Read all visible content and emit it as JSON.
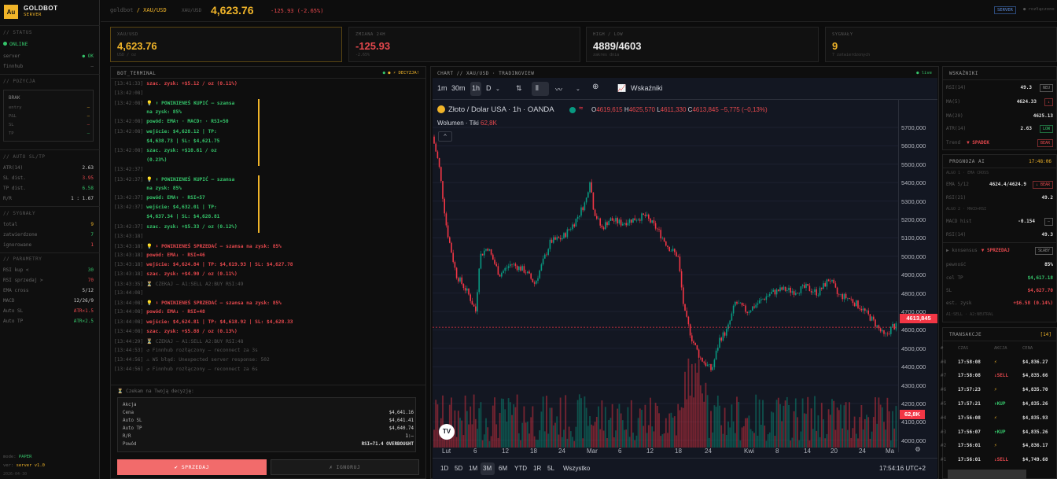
{
  "brand": {
    "logo": "Au",
    "name": "GOLDBOT",
    "sub": "SERVER"
  },
  "sidebar": {
    "status": {
      "title": "// STATUS",
      "online": "ONLINE",
      "server_label": "server",
      "server_value": "● OK",
      "finnhub_label": "finnhub",
      "finnhub_value": "—"
    },
    "position": {
      "title": "// POZYCJA",
      "state": "BRAK",
      "rows": [
        {
          "label": "entry",
          "value": "—"
        },
        {
          "label": "P&L",
          "value": "—"
        },
        {
          "label": "SL",
          "value": "—"
        },
        {
          "label": "TP",
          "value": "—"
        }
      ]
    },
    "autosltp": {
      "title": "// AUTO SL/TP",
      "rows": [
        {
          "label": "ATR(14)",
          "value": "2.63"
        },
        {
          "label": "SL dist.",
          "value": "3.95"
        },
        {
          "label": "TP dist.",
          "value": "6.58"
        },
        {
          "label": "R/R",
          "value": "1 : 1.67"
        }
      ]
    },
    "signals": {
      "title": "// SYGNAŁY",
      "rows": [
        {
          "label": "total",
          "value": "9"
        },
        {
          "label": "zatwierdzone",
          "value": "7"
        },
        {
          "label": "ignorowane",
          "value": "1"
        }
      ]
    },
    "params": {
      "title": "// PARAMETRY",
      "rows": [
        {
          "label": "RSI kup <",
          "value": "30"
        },
        {
          "label": "RSI sprzedaj >",
          "value": "70"
        },
        {
          "label": "EMA cross",
          "value": "5/12"
        },
        {
          "label": "MACD",
          "value": "12/26/9"
        },
        {
          "label": "Auto SL",
          "value": "ATR×1.5"
        },
        {
          "label": "Auto TP",
          "value": "ATR×2.5"
        }
      ]
    },
    "footer": {
      "mode_label": "mode:",
      "mode": "PAPER",
      "ver_label": "ver:",
      "ver": "server v1.0",
      "date": "2026-04-30"
    }
  },
  "header": {
    "path": "goldbot",
    "pair": "/ XAU/USD",
    "sym": "XAU/USD",
    "price": "4,623.76",
    "change": "-125.93 (-2.65%)",
    "server_badge": "SERVER",
    "conn": "● rozłączono"
  },
  "cards": [
    {
      "label": "XAU/USD",
      "value": "4,623.76",
      "sub": "USD / oz"
    },
    {
      "label": "ZMIANA 24H",
      "value": "-125.93",
      "sub": "-2.65%"
    },
    {
      "label": "HIGH / LOW",
      "value": "4889/4603",
      "sub": "zakres dnia"
    },
    {
      "label": "SYGNAŁY",
      "value": "9",
      "sub": "7 zatwierdzonych"
    }
  ],
  "terminal": {
    "title": "BOT_TERMINAL",
    "badge": "● ⚡ DECYZJA!",
    "lines": [
      {
        "ts": "[13:41:33]",
        "text": "szac. zysk: +$5.12 / oz (0.11%)",
        "c": "red"
      },
      {
        "ts": "[13:42:08]",
        "text": "",
        "c": "dim"
      },
      {
        "ts": "[13:42:08]",
        "text": "💡 ⬆ POWINIENEŚ KUPIĆ — szansa",
        "c": "green"
      },
      {
        "ts": "",
        "text": "na zysk: 85%",
        "c": "green"
      },
      {
        "ts": "[13:42:08]",
        "text": "powód: EMA↑ · MACD↑ · RSI=50",
        "c": "green"
      },
      {
        "ts": "[13:42:08]",
        "text": "wejście: $4,628.12 | TP:",
        "c": "green"
      },
      {
        "ts": "",
        "text": "$4,638.73 | SL: $4,621.75",
        "c": "green"
      },
      {
        "ts": "[13:42:08]",
        "text": "szac. zysk: +$10.61 / oz",
        "c": "green"
      },
      {
        "ts": "",
        "text": "(0.23%)",
        "c": "green"
      },
      {
        "ts": "[13:42:37]",
        "text": "",
        "c": "dim"
      },
      {
        "ts": "[13:42:37]",
        "text": "💡 ⬆ POWINIENEŚ KUPIĆ — szansa",
        "c": "green"
      },
      {
        "ts": "",
        "text": "na zysk: 85%",
        "c": "green"
      },
      {
        "ts": "[13:42:37]",
        "text": "powód: EMA↑ · RSI=57",
        "c": "green"
      },
      {
        "ts": "[13:42:37]",
        "text": "wejście: $4,632.01 | TP:",
        "c": "green"
      },
      {
        "ts": "",
        "text": "$4,637.34 | SL: $4,628.81",
        "c": "green"
      },
      {
        "ts": "[13:42:37]",
        "text": "szac. zysk: +$5.33 / oz (0.12%)",
        "c": "green"
      },
      {
        "ts": "[13:43:18]",
        "text": "",
        "c": "dim"
      },
      {
        "ts": "[13:43:18]",
        "text": "💡 ⬇ POWINIENEŚ SPRZEDAĆ — szansa na zysk: 85%",
        "c": "red"
      },
      {
        "ts": "[13:43:18]",
        "text": "powód: EMA↓ · RSI=46",
        "c": "red"
      },
      {
        "ts": "[13:43:18]",
        "text": "wejście: $4,624.84 | TP: $4,619.93 | SL: $4,627.78",
        "c": "red"
      },
      {
        "ts": "[13:43:18]",
        "text": "szac. zysk: +$4.90 / oz (0.11%)",
        "c": "red"
      },
      {
        "ts": "[13:43:35]",
        "text": "⏳ CZEKAJ — A1:SELL A2:BUY RSI:49",
        "c": "dim"
      },
      {
        "ts": "[13:44:08]",
        "text": "",
        "c": "dim"
      },
      {
        "ts": "[13:44:08]",
        "text": "💡 ⬇ POWINIENEŚ SPRZEDAĆ — szansa na zysk: 85%",
        "c": "red"
      },
      {
        "ts": "[13:44:08]",
        "text": "powód: EMA↓ · RSI=48",
        "c": "red"
      },
      {
        "ts": "[13:44:08]",
        "text": "wejście: $4,624.81 | TP: $4,618.92 | SL: $4,628.33",
        "c": "red"
      },
      {
        "ts": "[13:44:08]",
        "text": "szac. zysk: +$5.88 / oz (0.13%)",
        "c": "red"
      },
      {
        "ts": "[13:44:29]",
        "text": "⏳ CZEKAJ — A1:SELL A2:BUY RSI:48",
        "c": "dim"
      },
      {
        "ts": "[13:44:53]",
        "text": "↺ Finnhub rozłączony — reconnect za 3s",
        "c": "dim"
      },
      {
        "ts": "[13:44:56]",
        "text": "⚠ WS błąd: Unexpected server response: 502",
        "c": "dim"
      },
      {
        "ts": "[13:44:56]",
        "text": "↺ Finnhub rozłączony — reconnect za 6s",
        "c": "dim"
      }
    ],
    "waiting": "⏳ Czekam na Twoją decyzję:",
    "decision": {
      "rows": [
        {
          "label": "Akcja",
          "value": ""
        },
        {
          "label": "Cena",
          "value": "$4,641.16"
        },
        {
          "label": "Auto SL",
          "value": "$4,641.41"
        },
        {
          "label": "Auto TP",
          "value": "$4,640.74"
        },
        {
          "label": "R/R",
          "value": "1:—"
        },
        {
          "label": "Powód",
          "value": "RSI=71.4 OVERBOUGHT"
        }
      ]
    },
    "sell_label": "✔ SPRZEDAJ",
    "ignore_label": "✗ IGNORUJ"
  },
  "chart": {
    "title": "CHART // XAU/USD · TRADINGVIEW",
    "live": "● live",
    "intervals": [
      "1m",
      "30m",
      "1h",
      "D"
    ],
    "indicators_label": "Wskaźniki",
    "symbol_line": "Złoto / Dolar USA · 1h · OANDA",
    "ohlc": {
      "o": "4619,615",
      "h": "4625,570",
      "l": "4611,330",
      "c": "4613,845",
      "chg": "−5,775 (−0,13%)"
    },
    "volume_label": "Wolumen · Tiki",
    "volume_value": "62,8K",
    "price_tag": "4613,845",
    "vol_tag": "62,8K",
    "yticks": [
      "5700,000",
      "5600,000",
      "5500,000",
      "5400,000",
      "5300,000",
      "5200,000",
      "5100,000",
      "5000,000",
      "4900,000",
      "4800,000",
      "4700,000",
      "4600,000",
      "4500,000",
      "4400,000",
      "4300,000",
      "4200,000",
      "4100,000",
      "4000,000"
    ],
    "xticks": [
      "Lut",
      "6",
      "12",
      "18",
      "24",
      "Mar",
      "6",
      "12",
      "18",
      "24",
      "Kwi",
      "8",
      "14",
      "20",
      "24",
      "Ma"
    ],
    "ranges": [
      "1D",
      "5D",
      "1M",
      "3M",
      "6M",
      "YTD",
      "1R",
      "5L",
      "Wszystko"
    ],
    "time": "17:54:16 UTC+2"
  },
  "indicators": {
    "title": "WSKAŹNIKI",
    "rows": [
      {
        "label": "RSI(14)",
        "value": "49.3",
        "tag": "NEU"
      },
      {
        "label": "MA(5)",
        "value": "4624.33",
        "tag": "↓"
      },
      {
        "label": "MA(20)",
        "value": "4625.13",
        "tag": ""
      },
      {
        "label": "ATR(14)",
        "value": "2.63",
        "tag": "LOW"
      },
      {
        "label": "Trend",
        "value": "▼ SPADEK",
        "tag": "BEAR"
      }
    ]
  },
  "forecast": {
    "title": "PROGNOZA AI",
    "time": "17:48:06",
    "algo1": "ALGO 1 · EMA CROSS",
    "ema_label": "EMA 5/12",
    "ema_value": "4624.4/4624.9",
    "ema_tag": "↓ BEAR",
    "rsi21_label": "RSI(21)",
    "rsi21_value": "49.2",
    "algo2": "ALGO 2 · MACD+RSI",
    "macd_label": "MACD hist",
    "macd_value": "-0.154",
    "macd_tag": "—",
    "rsi14_label": "RSI(14)",
    "rsi14_value": "49.3",
    "consensus_label": "▶ konsensus",
    "consensus_value": "▼ SPRZEDAJ",
    "consensus_tag": "SŁABY",
    "rows": [
      {
        "label": "pewność",
        "value": "85%",
        "c": "white"
      },
      {
        "label": "cel TP",
        "value": "$4,617.18",
        "c": "green"
      },
      {
        "label": "SL",
        "value": "$4,627.70",
        "c": "red"
      },
      {
        "label": "est. zysk",
        "value": "+$6.58 (0.14%)",
        "c": "red"
      }
    ],
    "foot": "A1:SELL · A2:NEUTRAL"
  },
  "transactions": {
    "title": "TRANSAKCJE",
    "count": "[14]",
    "headers": [
      "#",
      "CZAS",
      "AKCJA",
      "CENA"
    ],
    "rows": [
      {
        "n": "#8",
        "time": "17:58:08",
        "action": "⚡",
        "price": "$4,836.27",
        "c": "gold"
      },
      {
        "n": "#7",
        "time": "17:58:08",
        "action": "↓SELL",
        "price": "$4,835.66",
        "c": "red"
      },
      {
        "n": "#6",
        "time": "17:57:23",
        "action": "⚡",
        "price": "$4,835.70",
        "c": "gold"
      },
      {
        "n": "#5",
        "time": "17:57:21",
        "action": "↑KUP",
        "price": "$4,835.26",
        "c": "green"
      },
      {
        "n": "#4",
        "time": "17:56:08",
        "action": "⚡",
        "price": "$4,835.93",
        "c": "gold"
      },
      {
        "n": "#3",
        "time": "17:56:07",
        "action": "↑KUP",
        "price": "$4,835.26",
        "c": "green"
      },
      {
        "n": "#2",
        "time": "17:56:01",
        "action": "⚡",
        "price": "$4,836.17",
        "c": "gold"
      },
      {
        "n": "#1",
        "time": "17:56:01",
        "action": "↓SELL",
        "price": "$4,749.68",
        "c": "red"
      }
    ]
  }
}
